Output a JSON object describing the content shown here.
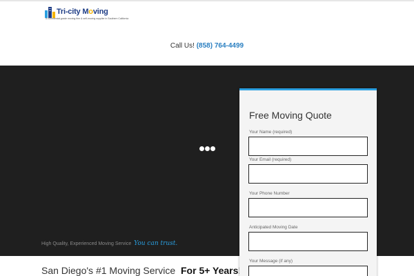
{
  "header": {
    "logo": {
      "name_part1": "Tri-city M",
      "name_highlight": "o",
      "name_part2": "ving",
      "tagline": "A commercial-grade moving firm & self-moving supplier in Southern California"
    },
    "call_label": "Call Us!",
    "phone": "(858) 764-4499"
  },
  "hero": {
    "tagline": "High Quality, Experienced Moving Service",
    "trust": "You can trust."
  },
  "headline": {
    "text": "San Diego's #1 Moving Service",
    "strong": "For 5+ Years!"
  },
  "quote_form": {
    "title": "Free Moving Quote",
    "fields": [
      {
        "label": "Your Name (required)",
        "value": ""
      },
      {
        "label": "Your Email (required)",
        "value": ""
      },
      {
        "label": "Your Phone Number",
        "value": ""
      },
      {
        "label": "Anticipated Moving Date",
        "value": ""
      },
      {
        "label": "Your Message (if any)",
        "value": ""
      }
    ]
  },
  "colors": {
    "accent": "#2a9fe0",
    "phone": "#2a7fc1",
    "hero_bg": "#1f1f1f",
    "logo_blue": "#1d3c85",
    "logo_yellow": "#f5b400"
  }
}
